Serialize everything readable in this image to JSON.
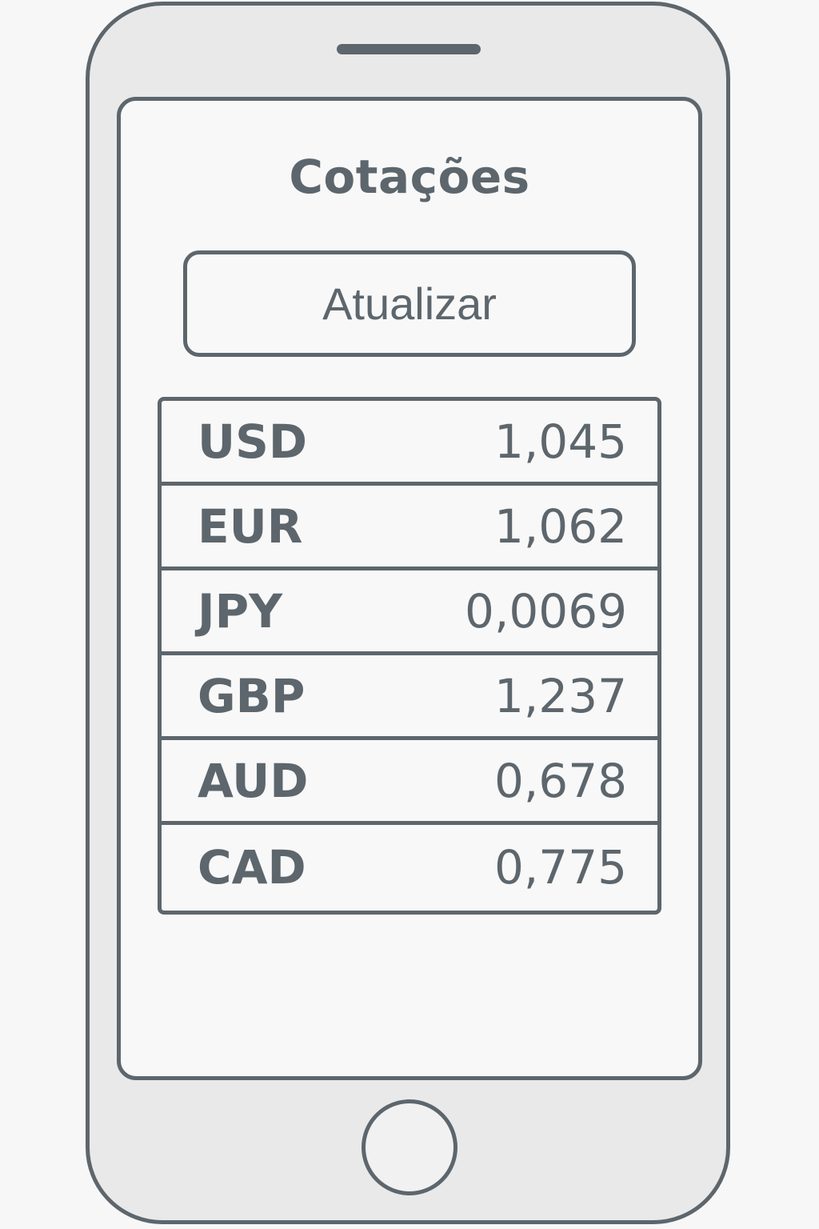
{
  "screen": {
    "title": "Cotações",
    "refresh_button_label": "Atualizar"
  },
  "rates": [
    {
      "code": "USD",
      "value": "1,045"
    },
    {
      "code": "EUR",
      "value": "1,062"
    },
    {
      "code": "JPY",
      "value": "0,0069"
    },
    {
      "code": "GBP",
      "value": "1,237"
    },
    {
      "code": "AUD",
      "value": "0,678"
    },
    {
      "code": "CAD",
      "value": "0,775"
    }
  ],
  "device": {
    "home_button_icon": "home-button-icon",
    "speaker_icon": "speaker-icon"
  },
  "colors": {
    "outline": "#5d666c",
    "screen_background": "#f8f8f8",
    "phone_body": "#e9e9e9"
  }
}
